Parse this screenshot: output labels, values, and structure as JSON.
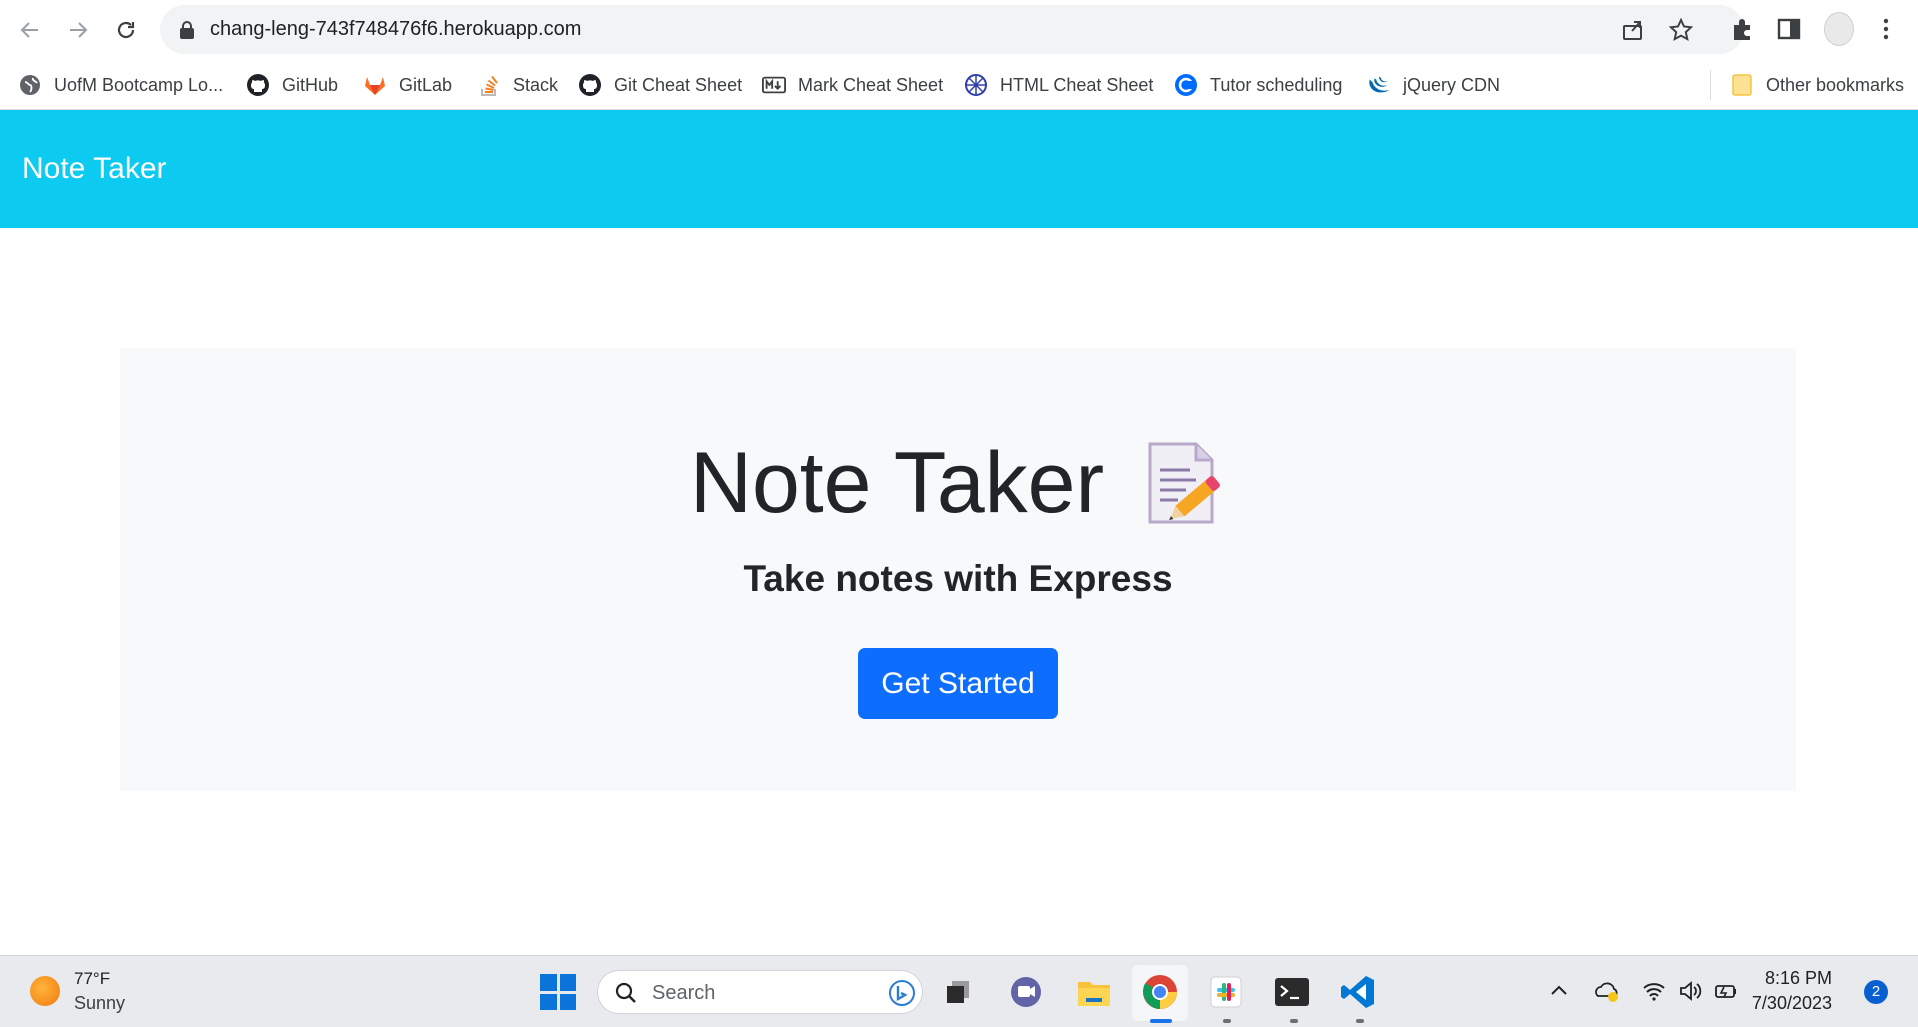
{
  "browser": {
    "url": "chang-leng-743f748476f6.herokuapp.com",
    "bookmarks": [
      {
        "label": "UofM Bootcamp Lo...",
        "icon": "globe-icon"
      },
      {
        "label": "GitHub",
        "icon": "github-icon"
      },
      {
        "label": "GitLab",
        "icon": "gitlab-icon"
      },
      {
        "label": "Stack",
        "icon": "stackoverflow-icon"
      },
      {
        "label": "Git Cheat Sheet",
        "icon": "github-icon"
      },
      {
        "label": "Mark Cheat Sheet",
        "icon": "markdown-icon"
      },
      {
        "label": "HTML Cheat Sheet",
        "icon": "compass-icon"
      },
      {
        "label": "Tutor scheduling",
        "icon": "calendly-icon"
      },
      {
        "label": "jQuery CDN",
        "icon": "jquery-icon"
      }
    ],
    "other_bookmarks": "Other bookmarks"
  },
  "app": {
    "brand": "Note Taker",
    "heading": "Note Taker",
    "heading_emoji": "memo-icon",
    "lead": "Take notes with Express",
    "cta": "Get Started",
    "colors": {
      "navbar": "#0dcaf0",
      "primary": "#0d6efd",
      "jumbotron": "#f8f9fa"
    }
  },
  "taskbar": {
    "weather": {
      "temp": "77°F",
      "condition": "Sunny"
    },
    "search_label": "Search",
    "time": "8:16 PM",
    "date": "7/30/2023",
    "notifications": "2"
  }
}
